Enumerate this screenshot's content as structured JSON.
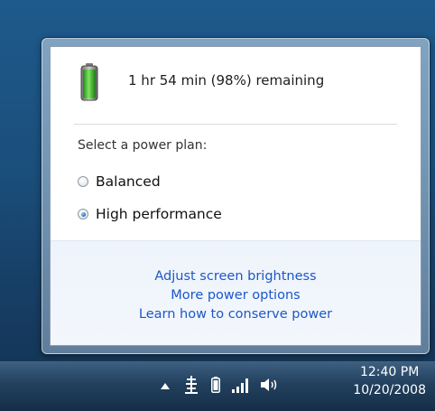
{
  "battery": {
    "status_text": "1 hr 54 min (98%) remaining",
    "charge_fraction": 0.98,
    "fill_color": "#38b82e"
  },
  "power_plan": {
    "heading": "Select a power plan:",
    "options": [
      {
        "label": "Balanced",
        "selected": false
      },
      {
        "label": "High performance",
        "selected": true
      }
    ]
  },
  "links": [
    "Adjust screen brightness",
    "More power options",
    "Learn how to conserve power"
  ],
  "taskbar": {
    "tray_icons": [
      "show-hidden-icons-arrow",
      "network-icon",
      "battery-icon",
      "signal-strength-icon",
      "volume-icon"
    ],
    "clock_time": "12:40 PM",
    "clock_date": "10/20/2008"
  }
}
